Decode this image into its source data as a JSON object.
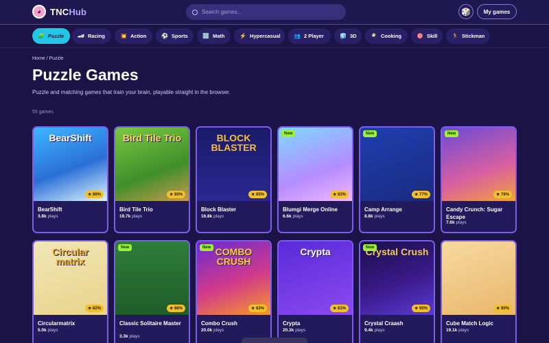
{
  "header": {
    "logo_prefix": "TNC",
    "logo_suffix": "Hub",
    "search_placeholder": "Search games...",
    "random_icon": "dice-icon",
    "my_games_label": "My games"
  },
  "categories": [
    {
      "label": "Puzzle",
      "icon": "🧩",
      "active": true
    },
    {
      "label": "Racing",
      "icon": "🏎",
      "active": false
    },
    {
      "label": "Action",
      "icon": "💥",
      "active": false
    },
    {
      "label": "Sports",
      "icon": "⚽",
      "active": false
    },
    {
      "label": "Math",
      "icon": "🔢",
      "active": false
    },
    {
      "label": "Hypercasual",
      "icon": "⚡",
      "active": false
    },
    {
      "label": "2 Player",
      "icon": "👥",
      "active": false
    },
    {
      "label": "3D",
      "icon": "🧊",
      "active": false
    },
    {
      "label": "Cooking",
      "icon": "🍳",
      "active": false
    },
    {
      "label": "Skill",
      "icon": "🎯",
      "active": false
    },
    {
      "label": "Stickman",
      "icon": "🏃",
      "active": false
    }
  ],
  "breadcrumb": "Home / Puzzle",
  "page": {
    "title": "Puzzle Games",
    "description": "Puzzle and matching games that train your brain, playable straight in the browser.",
    "count": "55 games"
  },
  "games": [
    {
      "title": "BearShift",
      "plays": "3.8k",
      "rating": "86%",
      "is_new": false,
      "art_text": "BearShift"
    },
    {
      "title": "Bird Tile Trio",
      "plays": "19.7k",
      "rating": "80%",
      "is_new": false,
      "art_text": "Bird Tile Trio"
    },
    {
      "title": "Block Blaster",
      "plays": "16.8k",
      "rating": "85%",
      "is_new": false,
      "art_text": "BLOCK BLASTER"
    },
    {
      "title": "Blumgi Merge Online",
      "plays": "6.6k",
      "rating": "83%",
      "is_new": true,
      "art_text": ""
    },
    {
      "title": "Camp Arrange",
      "plays": "8.8k",
      "rating": "77%",
      "is_new": true,
      "art_text": ""
    },
    {
      "title": "Candy Crunch: Sugar Escape",
      "plays": "7.6k",
      "rating": "76%",
      "is_new": true,
      "art_text": ""
    },
    {
      "title": "Circularmatrix",
      "plays": "5.0k",
      "rating": "82%",
      "is_new": false,
      "art_text": "Circular matrix"
    },
    {
      "title": "Classic Solitaire Master",
      "plays": "3.3k",
      "rating": "86%",
      "is_new": true,
      "art_text": ""
    },
    {
      "title": "Combo Crush",
      "plays": "20.0k",
      "rating": "83%",
      "is_new": true,
      "art_text": "COMBO CRUSH"
    },
    {
      "title": "Crypta",
      "plays": "20.3k",
      "rating": "81%",
      "is_new": false,
      "art_text": "Crypta"
    },
    {
      "title": "Crystal Craash",
      "plays": "9.4k",
      "rating": "90%",
      "is_new": true,
      "art_text": "Crystal Crush"
    },
    {
      "title": "Cube Match Logic",
      "plays": "19.1k",
      "rating": "90%",
      "is_new": false,
      "art_text": ""
    }
  ],
  "plays_suffix": "plays",
  "colors": {
    "background": "#1c1446",
    "active_category": "#22c7e8",
    "card_border": "#7d5cf0",
    "new_badge": "#9bf03a",
    "rating_badge": "#f3c02a"
  }
}
